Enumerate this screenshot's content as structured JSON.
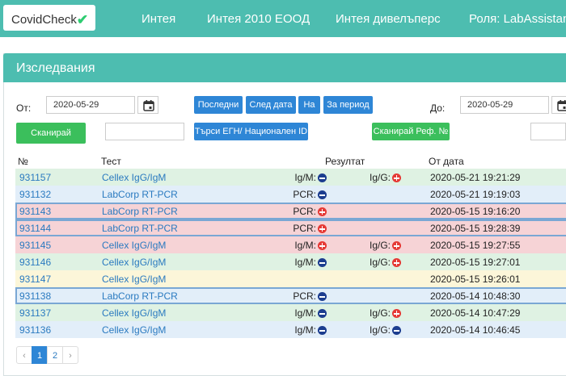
{
  "app": {
    "brand": "CovidCheck",
    "brand_check": "✔",
    "nav": [
      "Интея",
      "Интея 2010 ЕООД",
      "Интея дивелъперс",
      "Роля: LabAssistant"
    ]
  },
  "panel": {
    "title": "Изследвания"
  },
  "filters": {
    "from_label": "От:",
    "from_value": "2020-05-29",
    "to_label": "До:",
    "to_value": "2020-05-29",
    "buttons": [
      "Последни",
      "След дата",
      "На",
      "За период"
    ],
    "scan_label": "Сканирай",
    "search_egn_label": "Търси ЕГН/ Национален ID",
    "scan_ref_label": "Сканирай Реф. №"
  },
  "table": {
    "headers": [
      "№",
      "Тест",
      "Резултат",
      "От дата"
    ],
    "rows": [
      {
        "id": "931157",
        "test": "Cellex IgG/IgM",
        "r1_label": "Ig/M:",
        "r1": "neg",
        "r2_label": "Ig/G:",
        "r2": "pos",
        "date": "2020-05-21 19:21:29",
        "bg": "#dff2e3",
        "selected": false
      },
      {
        "id": "931132",
        "test": "LabCorp RT-PCR",
        "r1_label": "PCR:",
        "r1": "neg",
        "r2_label": "",
        "r2": "",
        "date": "2020-05-21 19:19:03",
        "bg": "#e2eef9",
        "selected": false
      },
      {
        "id": "931143",
        "test": "LabCorp RT-PCR",
        "r1_label": "PCR:",
        "r1": "pos",
        "r2_label": "",
        "r2": "",
        "date": "2020-05-15 19:16:20",
        "bg": "#f6d3d6",
        "selected": true
      },
      {
        "id": "931144",
        "test": "LabCorp RT-PCR",
        "r1_label": "PCR:",
        "r1": "pos",
        "r2_label": "",
        "r2": "",
        "date": "2020-05-15 19:28:39",
        "bg": "#f6d3d6",
        "selected": true
      },
      {
        "id": "931145",
        "test": "Cellex IgG/IgM",
        "r1_label": "Ig/M:",
        "r1": "pos",
        "r2_label": "Ig/G:",
        "r2": "pos",
        "date": "2020-05-15 19:27:55",
        "bg": "#f6d3d6",
        "selected": false
      },
      {
        "id": "931146",
        "test": "Cellex IgG/IgM",
        "r1_label": "Ig/M:",
        "r1": "neg",
        "r2_label": "Ig/G:",
        "r2": "pos",
        "date": "2020-05-15 19:27:01",
        "bg": "#dff2e3",
        "selected": false
      },
      {
        "id": "931147",
        "test": "Cellex IgG/IgM",
        "r1_label": "",
        "r1": "",
        "r2_label": "",
        "r2": "",
        "date": "2020-05-15 19:26:01",
        "bg": "#fcf6d9",
        "selected": false
      },
      {
        "id": "931138",
        "test": "LabCorp RT-PCR",
        "r1_label": "PCR:",
        "r1": "neg",
        "r2_label": "",
        "r2": "",
        "date": "2020-05-14 10:48:30",
        "bg": "#e2eef9",
        "selected": true
      },
      {
        "id": "931137",
        "test": "Cellex IgG/IgM",
        "r1_label": "Ig/M:",
        "r1": "neg",
        "r2_label": "Ig/G:",
        "r2": "pos",
        "date": "2020-05-14 10:47:29",
        "bg": "#dff2e3",
        "selected": false
      },
      {
        "id": "931136",
        "test": "Cellex IgG/IgM",
        "r1_label": "Ig/M:",
        "r1": "neg",
        "r2_label": "Ig/G:",
        "r2": "neg",
        "date": "2020-05-14 10:46:45",
        "bg": "#e2eef9",
        "selected": false
      }
    ]
  },
  "pagination": {
    "prev": "‹",
    "pages": [
      "1",
      "2"
    ],
    "active": "1",
    "next": "›"
  },
  "icons": {
    "negative": "minus-circle-icon",
    "positive": "plus-circle-icon",
    "calendar": "calendar-icon"
  },
  "colors": {
    "accent": "#4dbdb0",
    "button_blue": "#2e86d6",
    "button_green": "#3bbf5c",
    "negative": "#1c3d8f",
    "positive": "#e53935"
  }
}
